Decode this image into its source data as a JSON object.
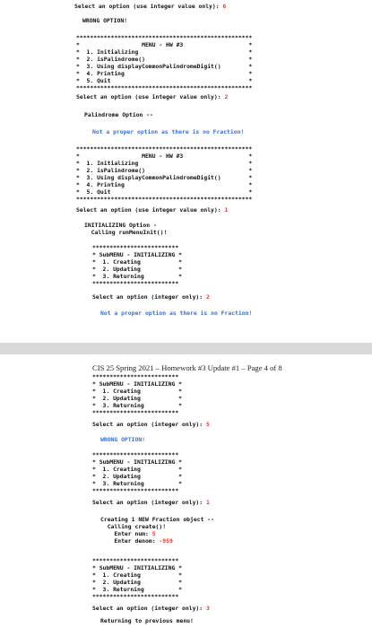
{
  "top_page": {
    "lines": [
      {
        "pre": "Select an option (use integer value only): ",
        "val": "6"
      },
      {
        "pre": "WRONG OPTION!"
      },
      {
        "pre": "***************************************************"
      },
      {
        "pre": "*                  MENU - HW #3                   *"
      },
      {
        "pre": "*  1. Initializing                                *"
      },
      {
        "pre": "*  2. isPalindrome()                              *"
      },
      {
        "pre": "*  3. Using displayCommonPalindromeDigit()        *"
      },
      {
        "pre": "*  4. Printing                                    *"
      },
      {
        "pre": "*  5. Quit                                        *"
      },
      {
        "pre": "***************************************************"
      },
      {
        "pre": "Select an option (use integer value only): ",
        "val": "2"
      },
      {
        "pre": "Palindrome Option --"
      },
      {
        "pre": "Not a proper option as there is no Fraction!",
        "blue": true
      },
      {
        "pre": "***************************************************"
      },
      {
        "pre": "*                  MENU - HW #3                   *"
      },
      {
        "pre": "*  1. Initializing                                *"
      },
      {
        "pre": "*  2. isPalindrome()                              *"
      },
      {
        "pre": "*  3. Using displayCommonPalindromeDigit()        *"
      },
      {
        "pre": "*  4. Printing                                    *"
      },
      {
        "pre": "*  5. Quit                                        *"
      },
      {
        "pre": "***************************************************"
      },
      {
        "pre": "Select an option (use integer value only): ",
        "val": "1"
      },
      {
        "pre": "INITIALIZING Option -"
      },
      {
        "pre": "  Calling runMenuInit()!"
      },
      {
        "pre": "*************************"
      },
      {
        "pre": "* SubMENU - INITIALIZING *"
      },
      {
        "pre": "*  1. Creating           *"
      },
      {
        "pre": "*  2. Updating           *"
      },
      {
        "pre": "*  3. Returning          *"
      },
      {
        "pre": "*************************"
      },
      {
        "pre": "Select an option (integer only): ",
        "val": "2"
      },
      {
        "pre": "Not a proper option as there is no Fraction!",
        "blue": true
      }
    ]
  },
  "bottom_page": {
    "header": "CIS 25 Spring 2021 – Homework #3 Update #1 – Page 4 of 8",
    "lines": [
      {
        "pre": "*************************"
      },
      {
        "pre": "* SubMENU - INITIALIZING *"
      },
      {
        "pre": "*  1. Creating           *"
      },
      {
        "pre": "*  2. Updating           *"
      },
      {
        "pre": "*  3. Returning          *"
      },
      {
        "pre": "*************************"
      },
      {
        "pre": "Select an option (integer only): ",
        "val": "5"
      },
      {
        "pre": "WRONG OPTION!",
        "blue": true
      },
      {
        "pre": "*************************"
      },
      {
        "pre": "* SubMENU - INITIALIZING *"
      },
      {
        "pre": "*  1. Creating           *"
      },
      {
        "pre": "*  2. Updating           *"
      },
      {
        "pre": "*  3. Returning          *"
      },
      {
        "pre": "*************************"
      },
      {
        "pre": "Select an option (integer only): ",
        "val": "1"
      },
      {
        "pre": "Creating 1 NEW Fraction object --"
      },
      {
        "pre": "  Calling create()!"
      },
      {
        "pre": "    Enter num: ",
        "val": "5"
      },
      {
        "pre": "    Enter denom: ",
        "val": "-959"
      },
      {
        "pre": "*************************"
      },
      {
        "pre": "* SubMENU - INITIALIZING *"
      },
      {
        "pre": "*  1. Creating           *"
      },
      {
        "pre": "*  2. Updating           *"
      },
      {
        "pre": "*  3. Returning          *"
      },
      {
        "pre": "*************************"
      },
      {
        "pre": "Select an option (integer only): ",
        "val": "3"
      },
      {
        "pre": "Returning to previous menu!"
      }
    ]
  }
}
